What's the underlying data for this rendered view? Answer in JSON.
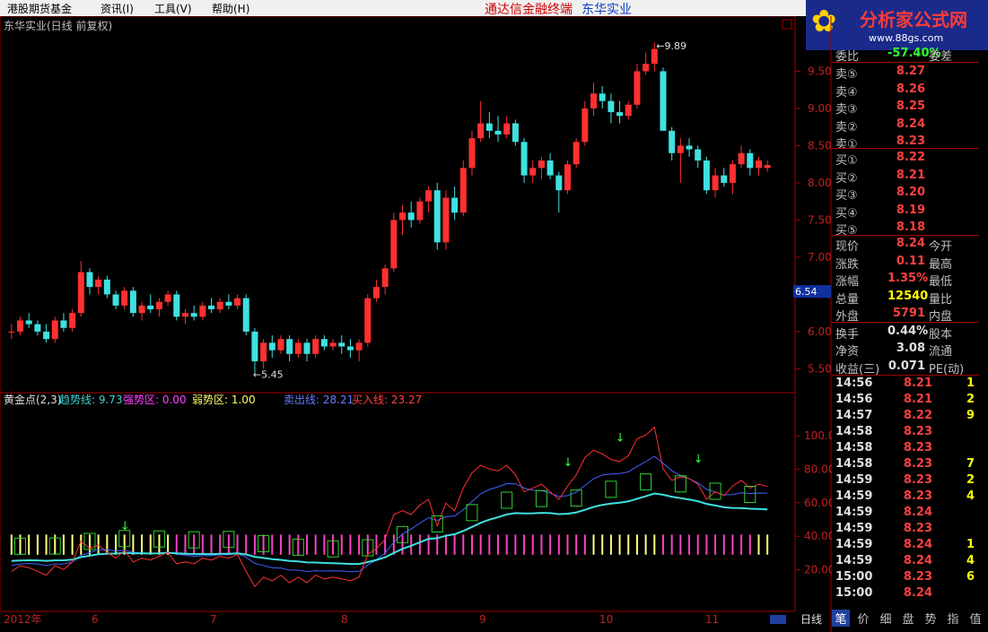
{
  "menu": {
    "items": [
      "港股期货基金",
      "资讯(I)",
      "工具(V)",
      "帮助(H)"
    ],
    "center_app": "通达信金融终端",
    "center_stock": "东华实业"
  },
  "logo": {
    "title": "分析家公式网",
    "url": "www.88gs.com"
  },
  "chart_title": "东华实业(日线 前复权)",
  "indicator": {
    "name": "黄金点(2,3)",
    "trend_label": "趋势线: 9.73",
    "strong_label": "强势区: 0.00",
    "weak_label": "弱势区: 1.00",
    "sell_label": "卖出线: 28.21",
    "buy_label": "买入线: 23.27"
  },
  "price_axis": [
    "9.50",
    "9.00",
    "8.50",
    "8.00",
    "7.50",
    "7.00",
    "6.50",
    "6.00",
    "5.50"
  ],
  "ind_axis": [
    "100.0",
    "80.00",
    "60.00",
    "40.00",
    "20.00"
  ],
  "current_price_tag": "6.54",
  "annotations": {
    "high": "9.89",
    "low": "5.45"
  },
  "date_axis": [
    "2012年",
    "6",
    "7",
    "8",
    "9",
    "10",
    "11"
  ],
  "period_label": "日线",
  "quote": {
    "header": "委比",
    "header_val": "-57.40%",
    "header_lab2": "委差",
    "sell": [
      {
        "l": "卖⑤",
        "v": "8.27"
      },
      {
        "l": "卖④",
        "v": "8.26"
      },
      {
        "l": "卖③",
        "v": "8.25"
      },
      {
        "l": "卖②",
        "v": "8.24"
      },
      {
        "l": "卖①",
        "v": "8.23"
      }
    ],
    "buy": [
      {
        "l": "买①",
        "v": "8.22"
      },
      {
        "l": "买②",
        "v": "8.21"
      },
      {
        "l": "买③",
        "v": "8.20"
      },
      {
        "l": "买④",
        "v": "8.19"
      },
      {
        "l": "买⑤",
        "v": "8.18"
      }
    ],
    "stats": [
      {
        "l": "现价",
        "v": "8.24",
        "l2": "今开",
        "c": "#ff4040"
      },
      {
        "l": "涨跌",
        "v": "0.11",
        "l2": "最高",
        "c": "#ff4040"
      },
      {
        "l": "涨幅",
        "v": "1.35%",
        "l2": "最低",
        "c": "#ff4040"
      },
      {
        "l": "总量",
        "v": "12540",
        "l2": "量比",
        "c": "#ffff00"
      },
      {
        "l": "外盘",
        "v": "5791",
        "l2": "内盘",
        "c": "#ff4040"
      },
      {
        "l": "换手",
        "v": "0.44%",
        "l2": "股本",
        "c": "#e0e0e0"
      },
      {
        "l": "净资",
        "v": "3.08",
        "l2": "流通",
        "c": "#e0e0e0"
      },
      {
        "l": "收益(三)",
        "v": "0.071",
        "l2": "PE(动)",
        "c": "#e0e0e0"
      }
    ]
  },
  "ticks": [
    {
      "t": "14:56",
      "p": "8.21",
      "v": "1"
    },
    {
      "t": "14:56",
      "p": "8.21",
      "v": "2"
    },
    {
      "t": "14:57",
      "p": "8.22",
      "v": "9"
    },
    {
      "t": "14:58",
      "p": "8.23",
      "v": ""
    },
    {
      "t": "14:58",
      "p": "8.23",
      "v": ""
    },
    {
      "t": "14:58",
      "p": "8.23",
      "v": "7"
    },
    {
      "t": "14:59",
      "p": "8.23",
      "v": "2"
    },
    {
      "t": "14:59",
      "p": "8.23",
      "v": "4"
    },
    {
      "t": "14:59",
      "p": "8.24",
      "v": ""
    },
    {
      "t": "14:59",
      "p": "8.23",
      "v": ""
    },
    {
      "t": "14:59",
      "p": "8.24",
      "v": "1"
    },
    {
      "t": "14:59",
      "p": "8.24",
      "v": "4"
    },
    {
      "t": "15:00",
      "p": "8.23",
      "v": "6"
    },
    {
      "t": "15:00",
      "p": "8.24",
      "v": ""
    }
  ],
  "tabs": [
    "笔",
    "价",
    "细",
    "盘",
    "势",
    "指",
    "值"
  ],
  "chart_data": {
    "type": "candlestick",
    "title": "东华实业(日线 前复权)",
    "ylim": [
      5.3,
      10.0
    ],
    "candles": [
      [
        6.0,
        6.1,
        5.9,
        6.0
      ],
      [
        6.0,
        6.2,
        5.95,
        6.15
      ],
      [
        6.15,
        6.25,
        6.05,
        6.1
      ],
      [
        6.1,
        6.15,
        5.95,
        6.0
      ],
      [
        6.0,
        6.1,
        5.85,
        5.9
      ],
      [
        5.9,
        6.2,
        5.85,
        6.15
      ],
      [
        6.15,
        6.25,
        6.0,
        6.05
      ],
      [
        6.05,
        6.3,
        6.0,
        6.25
      ],
      [
        6.25,
        6.95,
        6.2,
        6.8
      ],
      [
        6.8,
        6.85,
        6.5,
        6.6
      ],
      [
        6.6,
        6.75,
        6.5,
        6.7
      ],
      [
        6.7,
        6.75,
        6.45,
        6.5
      ],
      [
        6.5,
        6.55,
        6.3,
        6.35
      ],
      [
        6.35,
        6.6,
        6.3,
        6.55
      ],
      [
        6.55,
        6.6,
        6.2,
        6.25
      ],
      [
        6.25,
        6.4,
        6.15,
        6.35
      ],
      [
        6.35,
        6.5,
        6.25,
        6.3
      ],
      [
        6.3,
        6.45,
        6.2,
        6.4
      ],
      [
        6.4,
        6.55,
        6.35,
        6.5
      ],
      [
        6.5,
        6.55,
        6.15,
        6.2
      ],
      [
        6.2,
        6.3,
        6.1,
        6.25
      ],
      [
        6.25,
        6.35,
        6.15,
        6.2
      ],
      [
        6.2,
        6.4,
        6.15,
        6.35
      ],
      [
        6.35,
        6.45,
        6.25,
        6.3
      ],
      [
        6.3,
        6.45,
        6.25,
        6.4
      ],
      [
        6.4,
        6.5,
        6.3,
        6.35
      ],
      [
        6.35,
        6.5,
        6.3,
        6.45
      ],
      [
        6.45,
        6.5,
        5.95,
        6.0
      ],
      [
        6.0,
        6.05,
        5.45,
        5.6
      ],
      [
        5.6,
        5.9,
        5.5,
        5.85
      ],
      [
        5.85,
        5.95,
        5.65,
        5.75
      ],
      [
        5.75,
        5.95,
        5.7,
        5.9
      ],
      [
        5.9,
        5.95,
        5.6,
        5.7
      ],
      [
        5.7,
        5.9,
        5.65,
        5.85
      ],
      [
        5.85,
        5.9,
        5.6,
        5.7
      ],
      [
        5.7,
        5.95,
        5.65,
        5.9
      ],
      [
        5.9,
        5.95,
        5.75,
        5.8
      ],
      [
        5.8,
        5.9,
        5.75,
        5.85
      ],
      [
        5.85,
        5.95,
        5.7,
        5.8
      ],
      [
        5.8,
        5.9,
        5.65,
        5.75
      ],
      [
        5.75,
        5.9,
        5.6,
        5.85
      ],
      [
        5.85,
        6.5,
        5.8,
        6.45
      ],
      [
        6.45,
        6.7,
        6.4,
        6.6
      ],
      [
        6.6,
        6.9,
        6.5,
        6.85
      ],
      [
        6.85,
        7.6,
        6.8,
        7.5
      ],
      [
        7.5,
        7.7,
        7.3,
        7.6
      ],
      [
        7.6,
        7.75,
        7.4,
        7.5
      ],
      [
        7.5,
        7.8,
        7.45,
        7.75
      ],
      [
        7.75,
        7.95,
        7.6,
        7.9
      ],
      [
        7.9,
        8.0,
        7.1,
        7.2
      ],
      [
        7.2,
        7.9,
        7.1,
        7.8
      ],
      [
        7.8,
        7.95,
        7.5,
        7.6
      ],
      [
        7.6,
        8.3,
        7.55,
        8.2
      ],
      [
        8.2,
        8.7,
        8.1,
        8.6
      ],
      [
        8.6,
        9.1,
        8.55,
        8.8
      ],
      [
        8.8,
        8.95,
        8.6,
        8.7
      ],
      [
        8.7,
        8.9,
        8.55,
        8.65
      ],
      [
        8.65,
        8.9,
        8.6,
        8.8
      ],
      [
        8.8,
        8.85,
        8.5,
        8.55
      ],
      [
        8.55,
        8.6,
        8.0,
        8.1
      ],
      [
        8.1,
        8.3,
        8.0,
        8.2
      ],
      [
        8.2,
        8.35,
        8.05,
        8.3
      ],
      [
        8.3,
        8.4,
        8.05,
        8.1
      ],
      [
        8.1,
        8.15,
        7.6,
        7.9
      ],
      [
        7.9,
        8.3,
        7.85,
        8.25
      ],
      [
        8.25,
        8.6,
        8.2,
        8.55
      ],
      [
        8.55,
        9.1,
        8.5,
        9.0
      ],
      [
        9.0,
        9.35,
        8.9,
        9.2
      ],
      [
        9.2,
        9.3,
        9.0,
        9.1
      ],
      [
        9.1,
        9.2,
        8.8,
        8.95
      ],
      [
        8.95,
        9.1,
        8.8,
        8.9
      ],
      [
        8.9,
        9.1,
        8.85,
        9.05
      ],
      [
        9.05,
        9.6,
        9.0,
        9.5
      ],
      [
        9.5,
        9.75,
        9.45,
        9.6
      ],
      [
        9.6,
        9.89,
        9.5,
        9.8
      ],
      [
        9.5,
        9.55,
        8.7,
        8.7
      ],
      [
        8.7,
        8.75,
        8.3,
        8.4
      ],
      [
        8.4,
        8.6,
        8.0,
        8.5
      ],
      [
        8.5,
        8.6,
        8.35,
        8.45
      ],
      [
        8.45,
        8.5,
        8.2,
        8.3
      ],
      [
        8.3,
        8.35,
        7.85,
        7.9
      ],
      [
        7.9,
        8.2,
        7.8,
        8.1
      ],
      [
        8.1,
        8.2,
        7.95,
        8.0
      ],
      [
        8.0,
        8.3,
        7.85,
        8.25
      ],
      [
        8.25,
        8.5,
        8.2,
        8.4
      ],
      [
        8.4,
        8.45,
        8.1,
        8.2
      ],
      [
        8.2,
        8.35,
        8.1,
        8.3
      ],
      [
        8.2,
        8.3,
        8.15,
        8.24
      ]
    ]
  }
}
